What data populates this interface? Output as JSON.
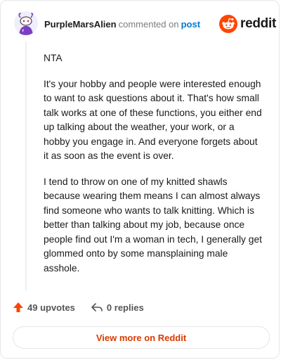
{
  "header": {
    "username": "PurpleMarsAlien",
    "commented_on": "commented on",
    "post_link": "post",
    "brand": "reddit",
    "avatar_icon": "snoo-avatar-icon",
    "brand_icon": "reddit-logo-icon"
  },
  "comment": {
    "paragraphs": [
      "NTA",
      "It's your hobby and people were interested enough to want to ask questions about it. That's how small talk works at one of these functions, you either end up talking about the weather, your work, or a hobby you engage in. And everyone forgets about it as soon as the event is over.",
      "I tend to throw on one of my knitted shawls because wearing them means I can almost always find someone who wants to talk knitting. Which is better than talking about my job, because once people find out I'm a woman in tech, I generally get glommed onto by some mansplaining male asshole."
    ]
  },
  "footer": {
    "upvotes": "49 upvotes",
    "replies": "0 replies",
    "view_more": "View more on Reddit"
  },
  "colors": {
    "accent": "#ff4500",
    "link": "#0079d3",
    "button_text": "#d93a00"
  }
}
